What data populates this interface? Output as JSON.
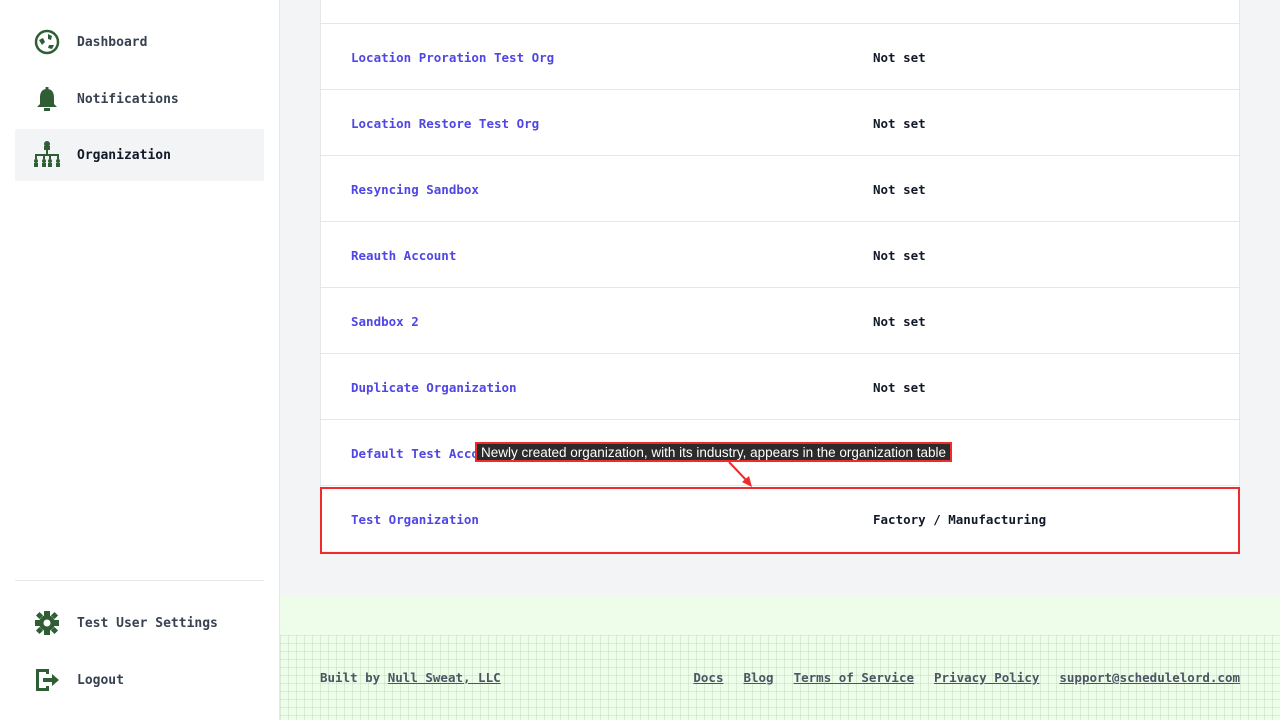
{
  "sidebar": {
    "items": [
      {
        "label": "Dashboard",
        "icon": "dashboard-icon"
      },
      {
        "label": "Notifications",
        "icon": "bell-icon"
      },
      {
        "label": "Organization",
        "icon": "org-chart-icon",
        "active": true
      }
    ],
    "bottom_items": [
      {
        "label": "Test User Settings",
        "icon": "gear-icon"
      },
      {
        "label": "Logout",
        "icon": "logout-icon"
      }
    ]
  },
  "table": {
    "rows": [
      {
        "name": "",
        "industry": ""
      },
      {
        "name": "Location Proration Test Org",
        "industry": "Not set"
      },
      {
        "name": "Location Restore Test Org",
        "industry": "Not set"
      },
      {
        "name": "Resyncing Sandbox",
        "industry": "Not set"
      },
      {
        "name": "Reauth Account",
        "industry": "Not set"
      },
      {
        "name": "Sandbox 2",
        "industry": "Not set"
      },
      {
        "name": "Duplicate Organization",
        "industry": "Not set"
      },
      {
        "name": "Default Test Account",
        "industry": ""
      },
      {
        "name": "Test Organization",
        "industry": "Factory / Manufacturing"
      }
    ]
  },
  "annotation": {
    "text": "Newly created organization, with its industry, appears in the organization table",
    "color": "#ef2b2b"
  },
  "footer": {
    "built_by_prefix": "Built by ",
    "built_by_link": "Null Sweat, LLC",
    "links": [
      "Docs",
      "Blog",
      "Terms of Service",
      "Privacy Policy",
      "support@schedulelord.com"
    ]
  },
  "colors": {
    "icon_green": "#2f5d34",
    "link_purple": "#4f46e5",
    "footer_bg": "#eefcea"
  }
}
